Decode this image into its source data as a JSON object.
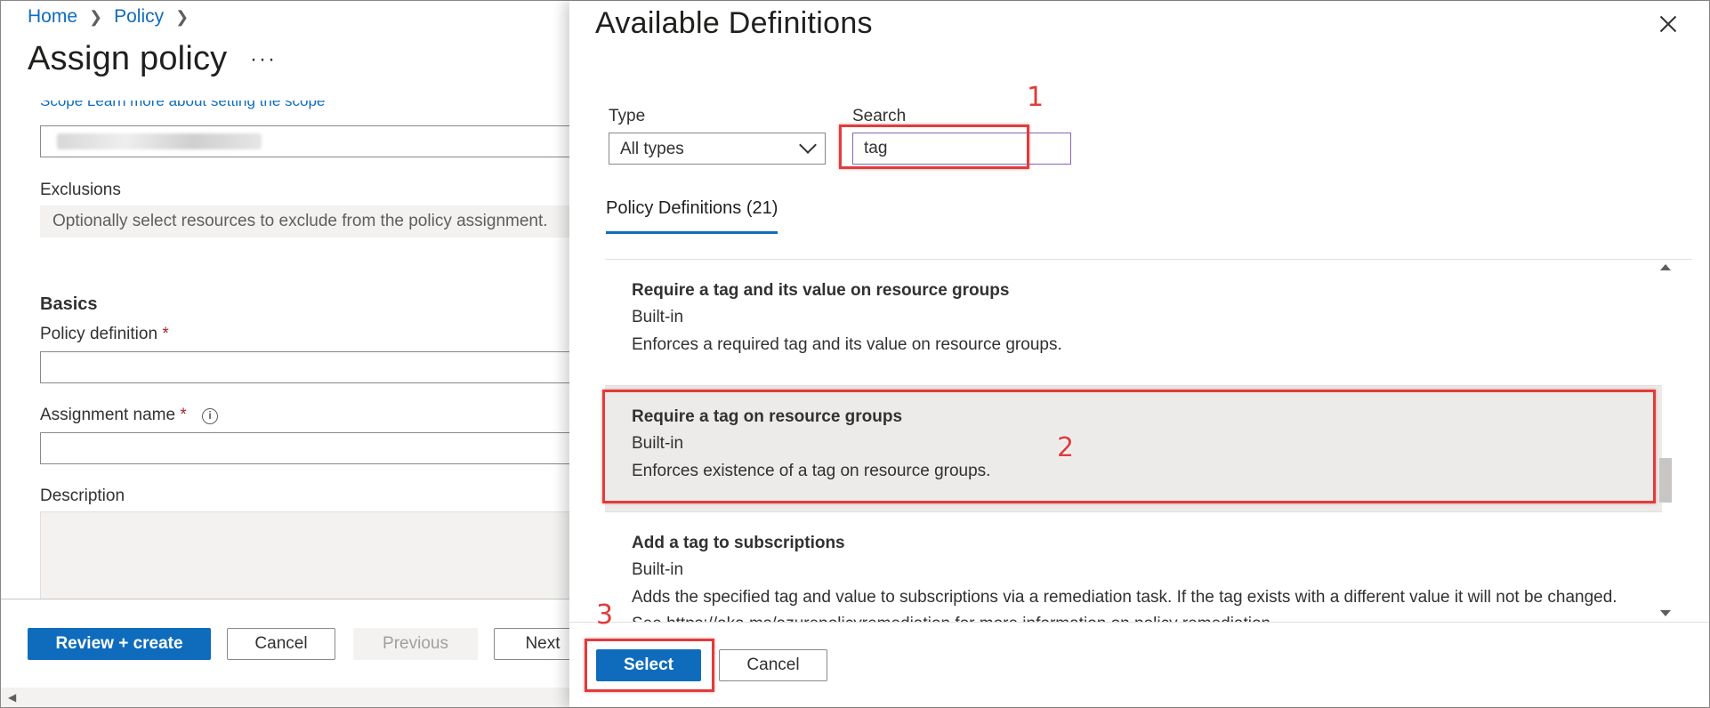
{
  "breadcrumb": {
    "home": "Home",
    "policy": "Policy"
  },
  "assign_policy": {
    "title": "Assign policy",
    "more": "···",
    "scope_link": "Scope  Learn more about setting the scope",
    "exclusions_label": "Exclusions",
    "exclusions_placeholder": "Optionally select resources to exclude from the policy assignment.",
    "basics_heading": "Basics",
    "policy_definition_label": "Policy definition",
    "assignment_name_label": "Assignment name",
    "required_mark": "*",
    "info_glyph": "i",
    "description_label": "Description",
    "footer": {
      "review_create": "Review + create",
      "cancel": "Cancel",
      "previous": "Previous",
      "next": "Next"
    }
  },
  "available_definitions": {
    "title": "Available Definitions",
    "type_label": "Type",
    "type_value": "All types",
    "search_label": "Search",
    "search_value": "tag",
    "tab_label": "Policy Definitions (21)",
    "items": [
      {
        "name": "Require a tag and its value on resource groups",
        "type": "Built-in",
        "description": "Enforces a required tag and its value on resource groups."
      },
      {
        "name": "Require a tag on resource groups",
        "type": "Built-in",
        "description": "Enforces existence of a tag on resource groups."
      },
      {
        "name": "Add a tag to subscriptions",
        "type": "Built-in",
        "description": "Adds the specified tag and value to subscriptions via a remediation task. If the tag exists with a different value it will not be changed.",
        "description_cont": "See https://aka.ms/azurepolicyremediation for more information on policy remediation."
      }
    ],
    "footer": {
      "select": "Select",
      "cancel": "Cancel"
    }
  },
  "annotations": [
    "1",
    "2",
    "3"
  ],
  "colors": {
    "accent": "#0f6cbd",
    "annotation": "#e03c3c",
    "selected_row": "#edebe9"
  }
}
